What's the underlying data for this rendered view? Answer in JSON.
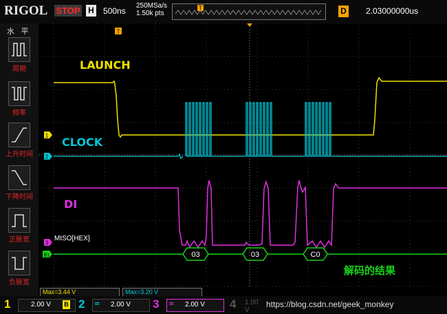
{
  "header": {
    "brand": "RIGOL",
    "run_state": "STOP",
    "horizontal_badge": "H",
    "timebase": "500ns",
    "sample_rate": "250MSa/s",
    "memory_depth": "1.50k pts",
    "delay_badge": "D",
    "delay_value": "2.03000000us",
    "trigger_marker": "T"
  },
  "sidebar": {
    "title": "水 平",
    "items": [
      {
        "label": "周期",
        "icon": "period-icon"
      },
      {
        "label": "频率",
        "icon": "frequency-icon"
      },
      {
        "label": "上升时间",
        "icon": "rise-time-icon"
      },
      {
        "label": "下降时间",
        "icon": "fall-time-icon"
      },
      {
        "label": "正脉宽",
        "icon": "positive-width-icon"
      },
      {
        "label": "负脉宽",
        "icon": "negative-width-icon"
      }
    ]
  },
  "traces": {
    "launch_label": "LAUNCH",
    "clock_label": "CLOCK",
    "di_label": "DI",
    "bus_label": "MISO[HEX]",
    "decode_values": [
      "03",
      "03",
      "C0"
    ],
    "annotation": "解码的结果",
    "markers": [
      "1",
      "2",
      "3",
      "B1"
    ]
  },
  "measurements": [
    {
      "label": "Max=3.44 V",
      "color": "#f0e000"
    },
    {
      "label": "Max=3.20 V",
      "color": "#00c8d8"
    }
  ],
  "channels": [
    {
      "num": "1",
      "glyph": "B",
      "volt": "2.00 V",
      "color": "#f0e000"
    },
    {
      "num": "2",
      "glyph": "",
      "volt": "2.00 V",
      "color": "#00c8d8"
    },
    {
      "num": "3",
      "glyph": "",
      "volt": "2.00 V",
      "color": "#e030e0"
    },
    {
      "num": "4",
      "glyph": "",
      "volt": "1.00 V",
      "color": "#555555"
    }
  ],
  "footer": {
    "watermark": "https://blog.csdn.net/geek_monkey"
  },
  "colors": {
    "ch1": "#f0e000",
    "ch2": "#00c8d8",
    "ch3": "#e030e0",
    "bus": "#18d018",
    "accent": "#f4a300"
  }
}
